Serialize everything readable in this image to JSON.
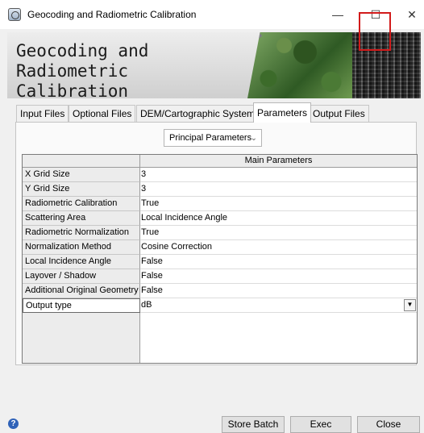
{
  "window": {
    "title": "Geocoding and Radiometric Calibration",
    "minimize_glyph": "—",
    "maximize_glyph": "☐",
    "close_glyph": "✕"
  },
  "banner": {
    "title_line1": "Geocoding and Radiometric",
    "title_line2": "Calibration"
  },
  "tabs": [
    {
      "label": "Input Files",
      "active": false
    },
    {
      "label": "Optional Files",
      "active": false
    },
    {
      "label": "DEM/Cartographic System",
      "active": false
    },
    {
      "label": "Parameters",
      "active": true
    },
    {
      "label": "Output Files",
      "active": false
    }
  ],
  "parameter_selector": {
    "value": "Principal Parameters"
  },
  "table": {
    "header": "Main Parameters",
    "rows": [
      {
        "label": "X Grid Size",
        "value": "3"
      },
      {
        "label": "Y Grid Size",
        "value": "3"
      },
      {
        "label": "Radiometric Calibration",
        "value": "True"
      },
      {
        "label": "Scattering Area",
        "value": "Local Incidence Angle"
      },
      {
        "label": "Radiometric Normalization",
        "value": "True"
      },
      {
        "label": "Normalization Method",
        "value": "Cosine Correction"
      },
      {
        "label": "Local Incidence Angle",
        "value": "False"
      },
      {
        "label": "Layover / Shadow",
        "value": "False"
      },
      {
        "label": "Additional Original Geometry",
        "value": "False"
      },
      {
        "label": "Output type",
        "value": "dB"
      }
    ]
  },
  "buttons": {
    "help": "?",
    "store_batch": "Store Batch",
    "exec": "Exec",
    "close": "Close"
  },
  "colors": {
    "accent_red": "#d21b1b",
    "help_blue": "#2f62b8"
  }
}
